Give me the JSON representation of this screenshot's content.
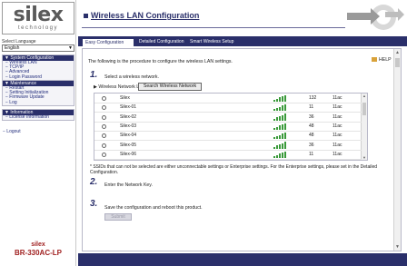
{
  "sidebar": {
    "logo": "silex",
    "logo_sub": "technology",
    "language_label": "Select Language",
    "language_value": "English",
    "sections": [
      {
        "title": "▼ System Configuration",
        "items": [
          "− Wireless LAN",
          "− TCP/IP",
          "− Advanced",
          "− Login Password"
        ]
      },
      {
        "title": "▼ Maintenance",
        "items": [
          "− Restart",
          "− Setting Initialization",
          "− Firmware Update",
          "− Log"
        ]
      },
      {
        "title": "▼ Information",
        "items": [
          "− License Information"
        ]
      }
    ],
    "logout": "− Logout",
    "brand_line1": "silex",
    "brand_line2": "BR-330AC-LP"
  },
  "header": {
    "title": "Wireless LAN Configuration"
  },
  "tabs": [
    "Easy Configuration",
    "Detailed Configuration",
    "Smart Wireless Setup"
  ],
  "content": {
    "intro": "The following is the procedure to configure the wireless LAN settings.",
    "help": "HELP",
    "step1_num": "1.",
    "step1_text": "Select a wireless network.",
    "wlan_list_label": "▶  Wireless Network List",
    "search_button": "Search Wireless Network",
    "networks": [
      {
        "ssid": "Silex",
        "signal": 5,
        "channel": "132",
        "standard": "11ac"
      },
      {
        "ssid": "Silex-01",
        "signal": 5,
        "channel": "11",
        "standard": "11ac"
      },
      {
        "ssid": "Silex-02",
        "signal": 5,
        "channel": "36",
        "standard": "11ac"
      },
      {
        "ssid": "Silex-03",
        "signal": 5,
        "channel": "48",
        "standard": "11ac"
      },
      {
        "ssid": "Silex-04",
        "signal": 5,
        "channel": "48",
        "standard": "11ac"
      },
      {
        "ssid": "Silex-05",
        "signal": 5,
        "channel": "36",
        "standard": "11ac"
      },
      {
        "ssid": "Silex-06",
        "signal": 5,
        "channel": "11",
        "standard": "11ac"
      }
    ],
    "note": "* SSIDs that can not be selected are either unconnectable settings or Enterprise settings. For the Enterprise settings, please set in the Detailed Configuration.",
    "step2_num": "2.",
    "step2_text": "Enter the Network Key.",
    "step3_num": "3.",
    "step3_text": "Save the configuration and reboot this product.",
    "submit_button": "Submit"
  },
  "colors": {
    "navy": "#2a2f6a",
    "brand_red": "#a02020",
    "signal_green": "#3a9a3a"
  }
}
